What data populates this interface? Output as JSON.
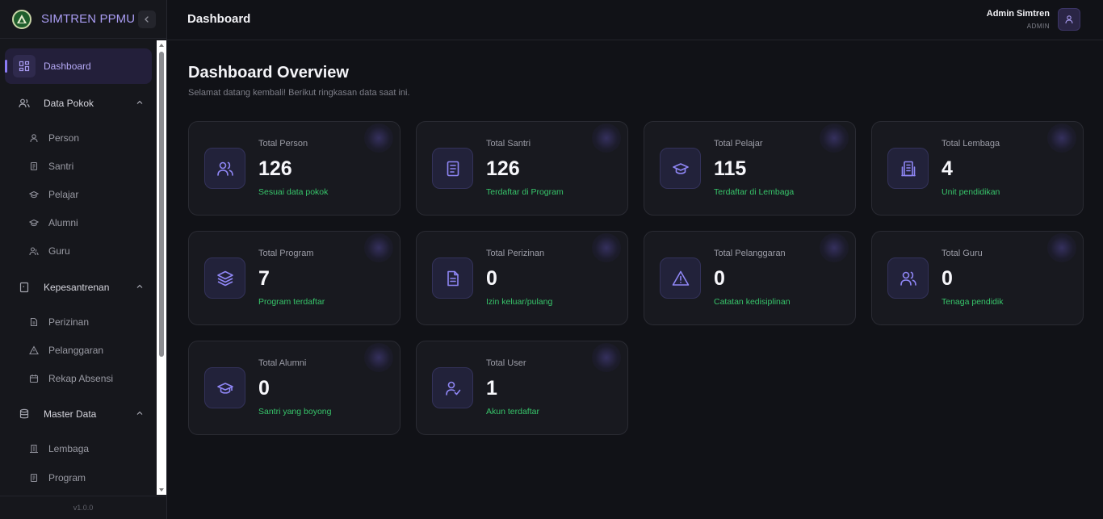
{
  "brand": {
    "name": "SIMTREN PPMU"
  },
  "header": {
    "title": "Dashboard",
    "user_name": "Admin Simtren",
    "user_role": "ADMIN"
  },
  "sidebar": {
    "items": [
      {
        "label": "Dashboard",
        "icon": "grid-icon",
        "active": true
      },
      {
        "label": "Data Pokok",
        "icon": "users-icon",
        "expanded": true,
        "children": [
          {
            "label": "Person",
            "icon": "user-icon"
          },
          {
            "label": "Santri",
            "icon": "document-icon"
          },
          {
            "label": "Pelajar",
            "icon": "graduation-cap-icon"
          },
          {
            "label": "Alumni",
            "icon": "graduation-cap-icon"
          },
          {
            "label": "Guru",
            "icon": "user-check-icon"
          }
        ]
      },
      {
        "label": "Kepesantrenan",
        "icon": "book-icon",
        "expanded": true,
        "children": [
          {
            "label": "Perizinan",
            "icon": "file-text-icon"
          },
          {
            "label": "Pelanggaran",
            "icon": "alert-triangle-icon"
          },
          {
            "label": "Rekap Absensi",
            "icon": "calendar-icon"
          }
        ]
      },
      {
        "label": "Master Data",
        "icon": "database-icon",
        "expanded": true,
        "children": [
          {
            "label": "Lembaga",
            "icon": "building-icon"
          },
          {
            "label": "Program",
            "icon": "document-icon"
          }
        ]
      }
    ],
    "version": "v1.0.0"
  },
  "main": {
    "title": "Dashboard Overview",
    "subtitle": "Selamat datang kembali! Berikut ringkasan data saat ini.",
    "cards": [
      {
        "title": "Total Person",
        "value": "126",
        "note": "Sesuai data pokok",
        "icon": "users-icon"
      },
      {
        "title": "Total Santri",
        "value": "126",
        "note": "Terdaftar di Program",
        "icon": "document-icon"
      },
      {
        "title": "Total Pelajar",
        "value": "115",
        "note": "Terdaftar di Lembaga",
        "icon": "graduation-cap-icon"
      },
      {
        "title": "Total Lembaga",
        "value": "4",
        "note": "Unit pendidikan",
        "icon": "building-icon"
      },
      {
        "title": "Total Program",
        "value": "7",
        "note": "Program terdaftar",
        "icon": "layers-icon"
      },
      {
        "title": "Total Perizinan",
        "value": "0",
        "note": "Izin keluar/pulang",
        "icon": "file-text-icon"
      },
      {
        "title": "Total Pelanggaran",
        "value": "0",
        "note": "Catatan kedisiplinan",
        "icon": "alert-triangle-icon"
      },
      {
        "title": "Total Guru",
        "value": "0",
        "note": "Tenaga pendidik",
        "icon": "users-icon"
      },
      {
        "title": "Total Alumni",
        "value": "0",
        "note": "Santri yang boyong",
        "icon": "graduation-cap-icon"
      },
      {
        "title": "Total User",
        "value": "1",
        "note": "Akun terdaftar",
        "icon": "user-check-icon"
      }
    ]
  },
  "colors": {
    "accent": "#8b7cf6",
    "success": "#37c46a",
    "background": "#111217",
    "card": "#18191f"
  }
}
